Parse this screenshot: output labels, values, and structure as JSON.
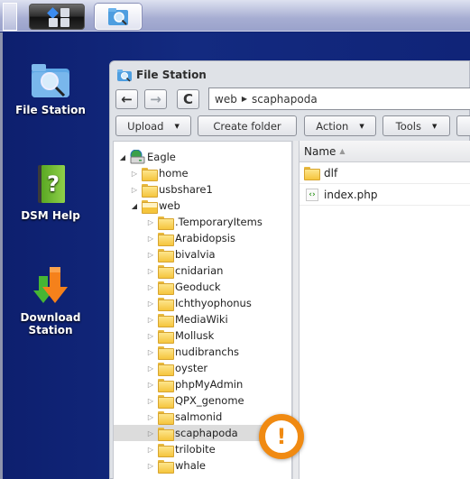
{
  "taskbar": {
    "main_menu_icon": "main-menu-icon",
    "file_station_icon": "file-station-icon"
  },
  "desktop": {
    "icons": [
      {
        "label": "File Station",
        "icon": "file-station-icon"
      },
      {
        "label": "DSM Help",
        "icon": "help-book-icon"
      },
      {
        "label": "Download Station",
        "label_line1": "Download",
        "label_line2": "Station",
        "icon": "download-arrows-icon"
      }
    ]
  },
  "window": {
    "title": "File Station",
    "nav": {
      "back_icon": "←",
      "forward_icon": "→",
      "refresh_icon": "C"
    },
    "path": {
      "segments": [
        "web",
        "scaphapoda"
      ],
      "separator": "▶"
    },
    "toolbar": {
      "upload_label": "Upload",
      "create_folder_label": "Create folder",
      "action_label": "Action",
      "tools_label": "Tools",
      "caret": "▼"
    },
    "tree": {
      "root": "Eagle",
      "items": [
        {
          "label": "home",
          "level": 1,
          "expanded": false
        },
        {
          "label": "usbshare1",
          "level": 1,
          "expanded": false
        },
        {
          "label": "web",
          "level": 1,
          "expanded": true
        },
        {
          "label": ".TemporaryItems",
          "level": 2,
          "expanded": false
        },
        {
          "label": "Arabidopsis",
          "level": 2,
          "expanded": false
        },
        {
          "label": "bivalvia",
          "level": 2,
          "expanded": false
        },
        {
          "label": "cnidarian",
          "level": 2,
          "expanded": false
        },
        {
          "label": "Geoduck",
          "level": 2,
          "expanded": false
        },
        {
          "label": "Ichthyophonus",
          "level": 2,
          "expanded": false
        },
        {
          "label": "MediaWiki",
          "level": 2,
          "expanded": false
        },
        {
          "label": "Mollusk",
          "level": 2,
          "expanded": false
        },
        {
          "label": "nudibranchs",
          "level": 2,
          "expanded": false
        },
        {
          "label": "oyster",
          "level": 2,
          "expanded": false
        },
        {
          "label": "phpMyAdmin",
          "level": 2,
          "expanded": false
        },
        {
          "label": "QPX_genome",
          "level": 2,
          "expanded": false
        },
        {
          "label": "salmonid",
          "level": 2,
          "expanded": false
        },
        {
          "label": "scaphapoda",
          "level": 2,
          "expanded": false,
          "selected": true
        },
        {
          "label": "trilobite",
          "level": 2,
          "expanded": false
        },
        {
          "label": "whale",
          "level": 2,
          "expanded": false
        }
      ]
    },
    "list": {
      "column_name": "Name",
      "sort_indicator": "▲",
      "rows": [
        {
          "name": "dlf",
          "type": "folder"
        },
        {
          "name": "index.php",
          "type": "php"
        }
      ]
    }
  },
  "warning_badge": {
    "symbol": "!",
    "color": "#f08a12"
  }
}
